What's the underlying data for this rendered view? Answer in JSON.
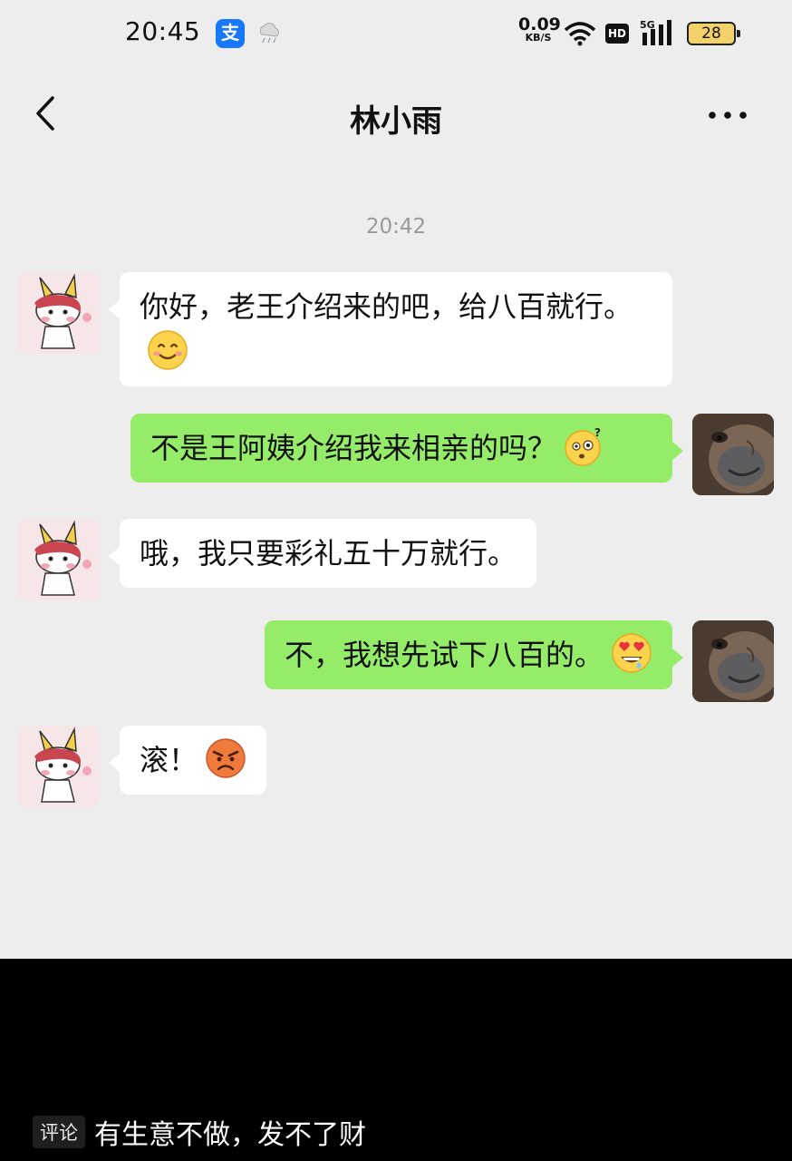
{
  "status_bar": {
    "time": "20:45",
    "alipay_glyph": "支",
    "weather_icon": "rain-cloud-icon",
    "net_speed": "0.09",
    "net_speed_unit": "KB/S",
    "hd_label": "HD",
    "signal_label": "5G",
    "battery": "28"
  },
  "nav": {
    "back_icon": "chevron-left-icon",
    "title": "林小雨",
    "more_icon": "more-horizontal-icon"
  },
  "chat": {
    "timestamp": "20:42",
    "messages": [
      {
        "side": "left",
        "text": "你好，老王介绍来的吧，给八百就行。",
        "emoji": "smiling-face-emoji"
      },
      {
        "side": "right",
        "text": "不是王阿姨介绍我来相亲的吗？",
        "emoji": "confused-face-emoji"
      },
      {
        "side": "left",
        "text": "哦，我只要彩礼五十万就行。",
        "emoji": ""
      },
      {
        "side": "right",
        "text": "不，我想先试下八百的。",
        "emoji": "heart-eyes-drool-emoji"
      },
      {
        "side": "left",
        "text": "滚！",
        "emoji": "angry-face-emoji"
      }
    ]
  },
  "footer": {
    "tag": "评论",
    "comment": "有生意不做，发不了财"
  },
  "colors": {
    "chat_bg": "#ededed",
    "outgoing_bubble": "#95ec69",
    "incoming_bubble": "#ffffff"
  }
}
